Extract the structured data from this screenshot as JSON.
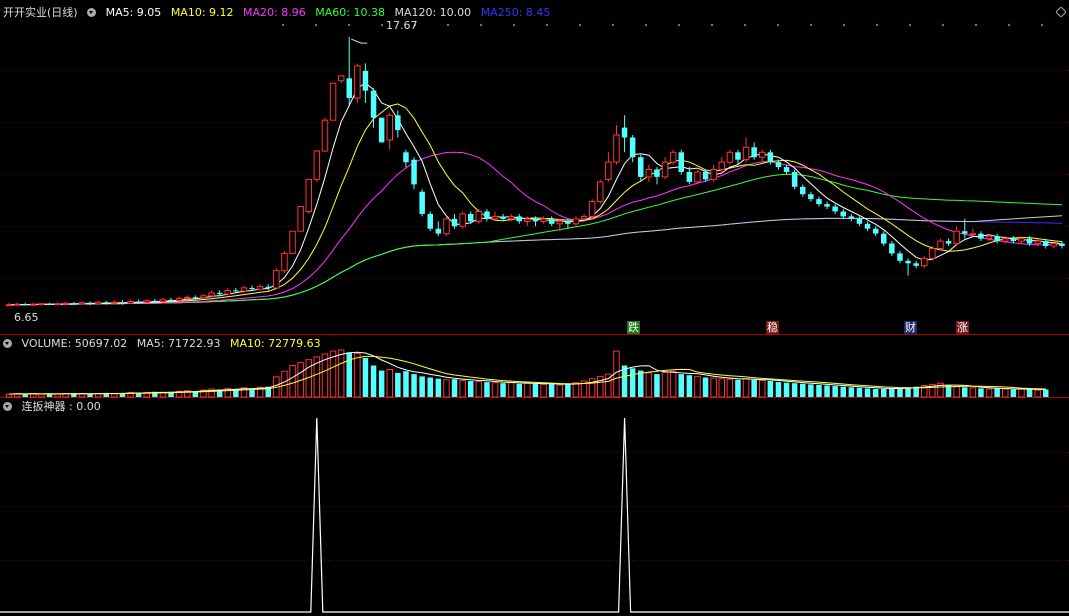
{
  "header": {
    "stock_name": "开开实业(日线)",
    "ma_items": [
      {
        "label": "MA5: 9.05",
        "color": "#ffffff"
      },
      {
        "label": "MA10: 9.12",
        "color": "#ffff33"
      },
      {
        "label": "MA20: 8.96",
        "color": "#ff33ff"
      },
      {
        "label": "MA60: 10.38",
        "color": "#33ff33"
      },
      {
        "label": "MA120: 10.00",
        "color": "#dddddd"
      },
      {
        "label": "MA250: 8.45",
        "color": "#3333ff"
      }
    ]
  },
  "price": {
    "high_label": "17.67",
    "low_label": "6.65"
  },
  "signals": [
    {
      "text": "跌",
      "bg": "#1a7a1a"
    },
    {
      "text": "稳",
      "bg": "#7a1a1a"
    },
    {
      "text": "财",
      "bg": "#1a2a6a"
    },
    {
      "text": "涨",
      "bg": "#7a1a1a"
    }
  ],
  "volume": {
    "header": [
      {
        "label": "VOLUME: 50697.02",
        "color": "#dddddd"
      },
      {
        "label": "MA5: 71722.93",
        "color": "#dddddd"
      },
      {
        "label": "MA10: 72779.63",
        "color": "#ffff33"
      }
    ]
  },
  "indicator": {
    "header": "连扳神器 : 0.00"
  },
  "colors": {
    "up": "#ff3333",
    "down": "#54ffff",
    "grid": "#7a0000",
    "spike": "#ffffff"
  },
  "chart_data": {
    "type": "candlestick",
    "price_ylim": [
      6.2,
      18.2
    ],
    "candles": [
      [
        6.81,
        6.82,
        6.8,
        6.9
      ],
      [
        6.82,
        6.84,
        6.8,
        6.9
      ],
      [
        6.84,
        6.81,
        6.8,
        6.9
      ],
      [
        6.81,
        6.84,
        6.8,
        6.9
      ],
      [
        6.84,
        6.86,
        6.8,
        6.9
      ],
      [
        6.86,
        6.83,
        6.8,
        6.9
      ],
      [
        6.83,
        6.86,
        6.8,
        6.92
      ],
      [
        6.86,
        6.88,
        6.8,
        6.93
      ],
      [
        6.88,
        6.85,
        6.8,
        6.93
      ],
      [
        6.85,
        6.9,
        6.8,
        6.95
      ],
      [
        6.9,
        6.86,
        6.8,
        6.95
      ],
      [
        6.86,
        6.92,
        6.8,
        6.98
      ],
      [
        6.92,
        6.88,
        6.82,
        6.98
      ],
      [
        6.88,
        6.92,
        6.82,
        7.0
      ],
      [
        6.92,
        6.89,
        6.82,
        7.0
      ],
      [
        6.89,
        6.95,
        6.85,
        7.03
      ],
      [
        6.95,
        6.92,
        6.85,
        7.03
      ],
      [
        6.92,
        6.98,
        6.88,
        7.05
      ],
      [
        6.98,
        6.95,
        6.88,
        7.05
      ],
      [
        6.95,
        7.02,
        6.9,
        7.1
      ],
      [
        7.02,
        7.0,
        6.92,
        7.1
      ],
      [
        7.0,
        7.08,
        6.95,
        7.15
      ],
      [
        7.08,
        7.12,
        7.0,
        7.2
      ],
      [
        7.12,
        7.1,
        7.02,
        7.2
      ],
      [
        7.1,
        7.18,
        7.05,
        7.25
      ],
      [
        7.18,
        7.3,
        7.1,
        7.4
      ],
      [
        7.3,
        7.25,
        7.15,
        7.4
      ],
      [
        7.25,
        7.4,
        7.2,
        7.5
      ],
      [
        7.4,
        7.38,
        7.3,
        7.5
      ],
      [
        7.38,
        7.5,
        7.3,
        7.6
      ],
      [
        7.5,
        7.45,
        7.4,
        7.6
      ],
      [
        7.45,
        7.55,
        7.4,
        7.65
      ],
      [
        7.55,
        7.5,
        7.4,
        7.65
      ],
      [
        7.5,
        8.2,
        7.5,
        8.3
      ],
      [
        8.2,
        8.9,
        8.1,
        9.0
      ],
      [
        8.9,
        9.8,
        8.9,
        9.8
      ],
      [
        9.8,
        10.8,
        9.8,
        10.8
      ],
      [
        10.6,
        11.9,
        10.5,
        11.9
      ],
      [
        11.9,
        13.05,
        11.8,
        13.1
      ],
      [
        13.05,
        14.3,
        13.0,
        14.4
      ],
      [
        14.3,
        15.8,
        14.3,
        15.8
      ],
      [
        15.9,
        16.1,
        15.8,
        16.1
      ],
      [
        16.0,
        15.2,
        14.9,
        17.67
      ],
      [
        15.2,
        16.5,
        15.0,
        16.6
      ],
      [
        16.3,
        15.5,
        15.0,
        16.6
      ],
      [
        15.5,
        14.4,
        14.0,
        15.6
      ],
      [
        14.4,
        13.4,
        13.4,
        14.4
      ],
      [
        13.5,
        14.5,
        13.1,
        14.6
      ],
      [
        14.5,
        13.9,
        13.6,
        14.7
      ],
      [
        13.0,
        12.6,
        12.4,
        13.1
      ],
      [
        12.7,
        11.7,
        11.5,
        12.8
      ],
      [
        11.4,
        10.5,
        10.4,
        11.5
      ],
      [
        10.5,
        9.9,
        9.8,
        10.6
      ],
      [
        9.9,
        9.7,
        9.6,
        10.2
      ],
      [
        9.7,
        10.3,
        9.6,
        10.4
      ],
      [
        10.3,
        10.0,
        9.9,
        10.5
      ],
      [
        10.0,
        10.5,
        9.9,
        10.6
      ],
      [
        10.5,
        10.2,
        10.1,
        10.6
      ],
      [
        10.2,
        10.6,
        10.1,
        10.7
      ],
      [
        10.6,
        10.3,
        10.2,
        10.7
      ],
      [
        10.3,
        10.4,
        10.2,
        10.6
      ],
      [
        10.4,
        10.3,
        10.2,
        10.5
      ],
      [
        10.3,
        10.4,
        10.2,
        10.5
      ],
      [
        10.4,
        10.2,
        10.1,
        10.5
      ],
      [
        10.2,
        10.3,
        10.0,
        10.4
      ],
      [
        10.3,
        10.2,
        10.0,
        10.4
      ],
      [
        10.2,
        10.3,
        10.1,
        10.4
      ],
      [
        10.3,
        10.1,
        10.0,
        10.4
      ],
      [
        10.1,
        10.2,
        9.8,
        10.3
      ],
      [
        10.2,
        10.1,
        9.9,
        10.3
      ],
      [
        10.1,
        10.3,
        10.0,
        10.4
      ],
      [
        10.3,
        10.4,
        10.2,
        10.5
      ],
      [
        10.4,
        11.0,
        10.3,
        11.1
      ],
      [
        11.0,
        11.8,
        10.9,
        11.9
      ],
      [
        11.9,
        12.6,
        11.8,
        13.0
      ],
      [
        12.6,
        13.7,
        12.5,
        14.1
      ],
      [
        14.0,
        13.6,
        13.0,
        14.5
      ],
      [
        13.6,
        12.8,
        12.6,
        13.7
      ],
      [
        12.8,
        12.0,
        11.8,
        12.9
      ],
      [
        12.0,
        12.3,
        11.8,
        12.5
      ],
      [
        12.3,
        12.0,
        11.7,
        12.4
      ],
      [
        12.0,
        12.6,
        11.9,
        12.8
      ],
      [
        12.6,
        13.0,
        12.5,
        13.1
      ],
      [
        13.0,
        12.2,
        12.1,
        13.1
      ],
      [
        12.2,
        11.8,
        11.7,
        12.4
      ],
      [
        11.8,
        12.2,
        11.7,
        12.3
      ],
      [
        12.2,
        11.9,
        11.8,
        12.3
      ],
      [
        11.9,
        12.3,
        11.8,
        12.5
      ],
      [
        12.3,
        12.6,
        12.2,
        12.8
      ],
      [
        12.6,
        13.0,
        12.5,
        13.1
      ],
      [
        13.0,
        12.7,
        12.5,
        13.1
      ],
      [
        12.7,
        13.2,
        12.6,
        13.6
      ],
      [
        13.2,
        12.8,
        12.7,
        13.4
      ],
      [
        12.8,
        13.0,
        12.6,
        13.1
      ],
      [
        13.0,
        12.6,
        12.5,
        13.1
      ],
      [
        12.6,
        12.4,
        12.3,
        12.7
      ],
      [
        12.4,
        12.2,
        12.1,
        12.5
      ],
      [
        12.2,
        11.6,
        11.5,
        12.3
      ],
      [
        11.6,
        11.3,
        11.2,
        11.7
      ],
      [
        11.3,
        11.1,
        11.0,
        11.4
      ],
      [
        11.1,
        10.9,
        10.8,
        11.2
      ],
      [
        10.9,
        10.8,
        10.7,
        11.0
      ],
      [
        10.8,
        10.6,
        10.5,
        10.9
      ],
      [
        10.6,
        10.4,
        10.3,
        10.7
      ],
      [
        10.4,
        10.3,
        10.2,
        10.5
      ],
      [
        10.3,
        10.1,
        10.0,
        10.4
      ],
      [
        10.1,
        9.9,
        9.8,
        10.2
      ],
      [
        9.9,
        9.7,
        9.6,
        10.0
      ],
      [
        9.7,
        9.3,
        9.2,
        9.8
      ],
      [
        9.3,
        8.9,
        8.8,
        9.4
      ],
      [
        8.9,
        8.6,
        8.5,
        9.0
      ],
      [
        8.6,
        8.5,
        8.0,
        8.7
      ],
      [
        8.5,
        8.4,
        8.3,
        8.6
      ],
      [
        8.4,
        8.7,
        8.3,
        8.8
      ],
      [
        8.7,
        9.1,
        8.6,
        9.2
      ],
      [
        9.1,
        9.4,
        9.0,
        9.5
      ],
      [
        9.4,
        9.3,
        9.2,
        9.5
      ],
      [
        9.3,
        9.8,
        9.2,
        10.0
      ],
      [
        9.8,
        9.7,
        9.5,
        10.3
      ],
      [
        9.7,
        9.7,
        9.6,
        9.9
      ],
      [
        9.7,
        9.5,
        9.4,
        9.8
      ],
      [
        9.5,
        9.6,
        9.4,
        9.7
      ],
      [
        9.6,
        9.4,
        9.3,
        9.7
      ],
      [
        9.4,
        9.5,
        9.3,
        9.6
      ],
      [
        9.5,
        9.4,
        9.3,
        9.6
      ],
      [
        9.4,
        9.5,
        9.3,
        9.6
      ],
      [
        9.5,
        9.3,
        9.2,
        9.6
      ],
      [
        9.3,
        9.4,
        9.2,
        9.5
      ],
      [
        9.4,
        9.2,
        9.1,
        9.5
      ],
      [
        9.2,
        9.3,
        9.1,
        9.4
      ],
      [
        9.3,
        9.2,
        9.1,
        9.4
      ]
    ],
    "volumes": [
      0.5,
      0.6,
      0.5,
      0.6,
      0.5,
      0.6,
      0.5,
      0.6,
      0.7,
      0.6,
      0.5,
      0.6,
      0.7,
      0.6,
      0.7,
      0.8,
      0.7,
      0.8,
      0.9,
      0.8,
      0.9,
      1.0,
      1.1,
      1.0,
      1.2,
      1.4,
      1.3,
      1.5,
      1.4,
      1.6,
      1.5,
      1.7,
      1.8,
      3.5,
      4.5,
      5.5,
      6.0,
      6.5,
      7.0,
      7.5,
      8.0,
      8.2,
      7.8,
      7.6,
      6.8,
      5.5,
      4.6,
      4.8,
      4.2,
      4.5,
      4.0,
      3.6,
      3.4,
      3.2,
      3.0,
      3.1,
      2.9,
      2.8,
      2.7,
      2.6,
      2.5,
      2.4,
      2.5,
      2.3,
      2.4,
      2.3,
      2.2,
      2.3,
      2.1,
      2.2,
      2.5,
      2.8,
      3.2,
      3.6,
      4.0,
      8.0,
      5.5,
      5.0,
      4.6,
      4.2,
      4.0,
      4.3,
      4.5,
      4.0,
      3.8,
      3.6,
      3.4,
      3.3,
      3.2,
      3.1,
      3.0,
      3.2,
      3.0,
      2.9,
      2.8,
      2.6,
      2.5,
      2.4,
      2.3,
      2.2,
      2.1,
      2.0,
      1.9,
      1.8,
      1.7,
      1.6,
      1.5,
      1.4,
      1.4,
      1.5,
      1.6,
      1.7,
      1.8,
      2.0,
      2.2,
      2.4,
      2.0,
      1.8,
      1.7,
      1.6,
      1.5,
      1.4,
      1.5,
      1.4,
      1.3,
      1.4,
      1.3,
      1.2,
      1.3
    ],
    "indicator_spikes": [
      38,
      76
    ]
  }
}
